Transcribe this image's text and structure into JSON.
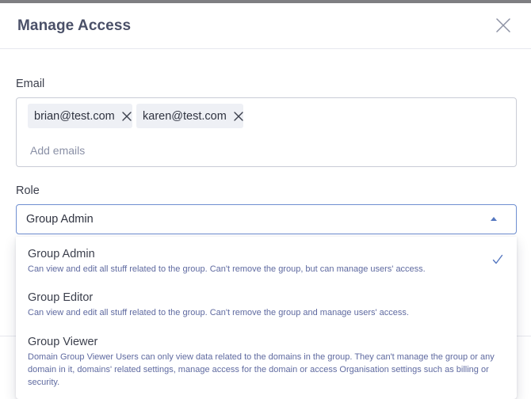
{
  "modal": {
    "title": "Manage Access"
  },
  "email": {
    "label": "Email",
    "chips": [
      {
        "text": "brian@test.com"
      },
      {
        "text": "karen@test.com"
      }
    ],
    "placeholder": "Add emails",
    "value": ""
  },
  "role": {
    "label": "Role",
    "selected": "Group Admin",
    "options": [
      {
        "title": "Group Admin",
        "description": "Can view and edit all stuff related to the group. Can't remove the group, but can manage users' access.",
        "checked": true
      },
      {
        "title": "Group Editor",
        "description": "Can view and edit all stuff related to the group. Can't remove the group and manage users' access.",
        "checked": false
      },
      {
        "title": "Group Viewer",
        "description": "Domain Group Viewer Users can only view data related to the domains in the group. They can't manage the group or any domain in it, domains' related settings, manage access for the domain or access Organisation settings such as billing or security.",
        "checked": false
      }
    ]
  },
  "icons": {
    "close": "close-icon",
    "chip_remove": "close-icon",
    "dropdown_caret": "caret-up-icon",
    "selected_check": "check-icon"
  },
  "colors": {
    "title": "#4a5068",
    "focus_border": "#6f8fd1",
    "accent": "#5577c0",
    "description": "#5f6aa0",
    "chip_background": "#eef0f5",
    "placeholder": "#8a90a6"
  }
}
